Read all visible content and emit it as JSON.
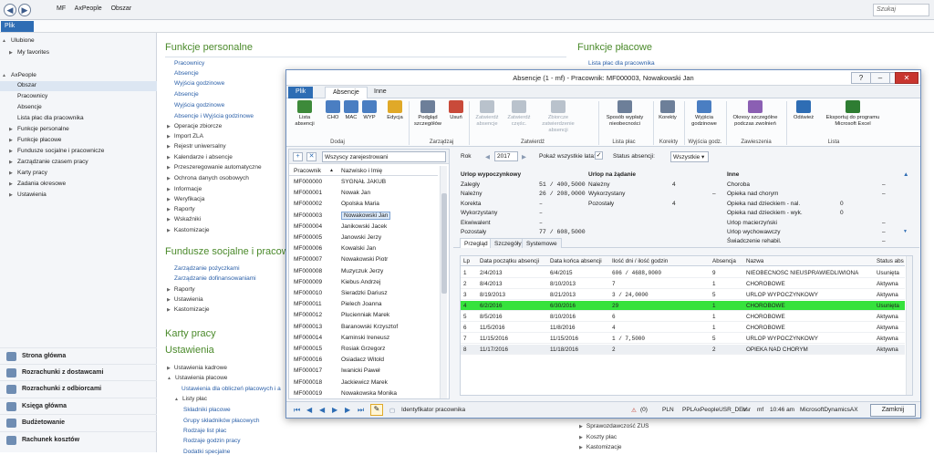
{
  "address": {
    "crumbs": [
      "MF",
      "AxPeople",
      "Obszar"
    ],
    "search_placeholder": "Szukaj"
  },
  "file_menu": "Plik",
  "sidebar": {
    "items": [
      {
        "label": "Ulubione",
        "level": 0,
        "arrow": "▲"
      },
      {
        "label": "My favorites",
        "level": 1,
        "arrow": "▶"
      },
      {
        "label": "AxPeople",
        "level": 0,
        "arrow": "▲"
      },
      {
        "label": "Obszar",
        "level": 1,
        "arrow": "",
        "selected": true
      },
      {
        "label": "Pracownicy",
        "level": 1,
        "arrow": ""
      },
      {
        "label": "Absencje",
        "level": 1,
        "arrow": ""
      },
      {
        "label": "Lista płac dla pracownika",
        "level": 1,
        "arrow": ""
      },
      {
        "label": "Funkcje personalne",
        "level": 1,
        "arrow": "▶"
      },
      {
        "label": "Funkcje płacowe",
        "level": 1,
        "arrow": "▶"
      },
      {
        "label": "Fundusze socjalne i pracownicze",
        "level": 1,
        "arrow": "▶"
      },
      {
        "label": "Zarządzanie czasem pracy",
        "level": 1,
        "arrow": "▶"
      },
      {
        "label": "Karty pracy",
        "level": 1,
        "arrow": "▶"
      },
      {
        "label": "Zadania okresowe",
        "level": 1,
        "arrow": "▶"
      },
      {
        "label": "Ustawienia",
        "level": 1,
        "arrow": "▶"
      }
    ],
    "nav": [
      "Strona główna",
      "Rozrachunki z dostawcami",
      "Rozrachunki z odbiorcami",
      "Księga główna",
      "Budżetowanie",
      "Rachunek kosztów"
    ]
  },
  "content": {
    "sections": {
      "personal": "Funkcje personalne",
      "payroll": "Funkcje płacowe",
      "funds": "Fundusze socjalne i pracow",
      "cards": "Karty pracy",
      "settings": "Ustawienia"
    },
    "personal_links": [
      "Pracownicy",
      "Absencje",
      "Wyjścia godzinowe",
      "Absencje",
      "Wyjścia godzinowe",
      "Absencje i Wyjścia godzinowe"
    ],
    "personal_groups": [
      "Operacje zbiorcze",
      "Import ZLA",
      "Rejestr uniwersalny",
      "Kalendarze i absencje",
      "Przeszeregowanie automatyczne",
      "Ochrona danych osobowych",
      "Informacje",
      "Weryfikacja",
      "Raporty",
      "Wskaźniki",
      "Kastomizacje"
    ],
    "payroll_link": "Lista płac dla pracownika",
    "funds_links": [
      "Zarządzanie pożyczkami",
      "Zarządzanie dofinansowaniami"
    ],
    "funds_groups": [
      "Raporty",
      "Ustawienia",
      "Kastomizacje"
    ],
    "settings_items": [
      "Ustawienia kadrowe",
      "Ustawienia płacowe",
      "Ustawienia dla obliczeń płacowych i a",
      "Listy płac",
      "Składniki płacowe",
      "Grupy składników płacowych",
      "Rodzaje list płac",
      "Rodzaje godzin pracy",
      "Dodatki specjalne"
    ],
    "bottom_right": [
      "Sprawozdawczość ZUS",
      "Koszty płac",
      "Kastomizacje"
    ]
  },
  "dialog": {
    "title": "Absencje (1 - mf) - Pracownik: MF000003, Nowakowski Jan",
    "tabs": {
      "file": "Plik",
      "active": "Absencje",
      "other": "Inne"
    },
    "ribbon_buttons": [
      {
        "label": "Lista absencji",
        "color": "#3d8a3a",
        "dis": false
      },
      {
        "label": "CHO",
        "color": "#4a7ec2",
        "dis": false
      },
      {
        "label": "MAC",
        "color": "#4a7ec2",
        "dis": false
      },
      {
        "label": "WYP",
        "color": "#4a7ec2",
        "dis": false
      },
      {
        "label": "Edycja",
        "color": "#e0a928",
        "dis": false
      },
      {
        "label": "Podgląd szczegółów",
        "color": "#6d7f99",
        "dis": false
      },
      {
        "label": "Usuń",
        "color": "#c94a3a",
        "dis": false
      },
      {
        "label": "Zatwierdź absencje",
        "color": "#b9c2cc",
        "dis": true
      },
      {
        "label": "Zatwierdź częśc.",
        "color": "#b9c2cc",
        "dis": true
      },
      {
        "label": "Zbiorcze zatwierdzenie absencji",
        "color": "#b9c2cc",
        "dis": true
      },
      {
        "label": "Sposób wypłaty nieobecności",
        "color": "#6d7f99",
        "dis": false
      },
      {
        "label": "Korekty",
        "color": "#6d7f99",
        "dis": false
      },
      {
        "label": "Wyjścia godzinowe",
        "color": "#4a7ec2",
        "dis": false
      },
      {
        "label": "Okresy szczególne podczas zwolnień",
        "color": "#8b5fb3",
        "dis": false
      },
      {
        "label": "Odśwież",
        "color": "#2e6db4",
        "dis": false
      },
      {
        "label": "Eksportuj do programu Microsoft Excel",
        "color": "#2e7d32",
        "dis": false
      }
    ],
    "ribbon_groups": [
      "Dodaj",
      "Zarządzaj",
      "Zatwierdź",
      "Lista płac",
      "Korekty",
      "Wyjścia godz.",
      "Zawieszenia",
      "Lista"
    ],
    "filter": "Wszyscy zarejestrowani",
    "emp_headers": [
      "Pracownik",
      "Nazwisko i Imię"
    ],
    "employees": [
      [
        "MF000000",
        "SYGNAŁ JAKUB"
      ],
      [
        "MF000001",
        "Nowak Jan"
      ],
      [
        "MF000002",
        "Opolska Maria"
      ],
      [
        "MF000003",
        "Nowakowski Jan"
      ],
      [
        "MF000004",
        "Janikowski Jacek"
      ],
      [
        "MF000005",
        "Janowski Jerzy"
      ],
      [
        "MF000006",
        "Kowalski Jan"
      ],
      [
        "MF000007",
        "Nowakowski Piotr"
      ],
      [
        "MF000008",
        "Muzyczuk Jerzy"
      ],
      [
        "MF000009",
        "Kiebus Andrzej"
      ],
      [
        "MF000010",
        "Sieradzki Dariusz"
      ],
      [
        "MF000011",
        "Pielech Joanna"
      ],
      [
        "MF000012",
        "Plucienniak Marek"
      ],
      [
        "MF000013",
        "Baranowski Krzysztof"
      ],
      [
        "MF000014",
        "Kaminski Ireneusz"
      ],
      [
        "MF000015",
        "Rosiak Grzegorz"
      ],
      [
        "MF000016",
        "Osiadacz Witold"
      ],
      [
        "MF000017",
        "Iwanicki Paweł"
      ],
      [
        "MF000018",
        "Jackiewicz Marek"
      ],
      [
        "MF000019",
        "Nowakowska Monika"
      ]
    ],
    "rok_label": "Rok",
    "rok": "2017",
    "show_all": "Pokaż wszystkie lata:",
    "status_label": "Status absencji:",
    "status_value": "Wszystkie",
    "leave": {
      "title": "Urlop wypoczynkowy",
      "rows": [
        [
          "Zaległy",
          "51 / 400,5000"
        ],
        [
          "Należny",
          "26 / 208,0000"
        ],
        [
          "Korekta",
          "–"
        ],
        [
          "Wykorzystany",
          "–"
        ],
        [
          "Ekwiwalent",
          "–"
        ],
        [
          "Pozostały",
          "77 / 608,5000"
        ]
      ]
    },
    "demand": {
      "title": "Urlop na żądanie",
      "rows": [
        [
          "Należny",
          "4"
        ],
        [
          "Wykorzystany",
          "–"
        ],
        [
          "Pozostały",
          "4"
        ]
      ]
    },
    "other": {
      "title": "Inne",
      "rows": [
        [
          "Choroba",
          "–"
        ],
        [
          "Opieka nad chorym",
          "–"
        ],
        [
          "Opieka nad dzieckiem - nal.",
          "0"
        ],
        [
          "Opieka nad dzieckiem - wyk.",
          "0"
        ],
        [
          "Urlop macierzyński",
          "–"
        ],
        [
          "Urlop wychowawczy",
          "–"
        ],
        [
          "Świadczenie rehabil.",
          "–"
        ]
      ]
    },
    "sub_tabs": [
      "Przegląd",
      "Szczegóły",
      "Systemowe"
    ],
    "grid_headers": [
      "Lp",
      "Data początku absencji",
      "Data końca absencji",
      "Ilość dni / ilość godzin",
      "Absencja",
      "Nazwa",
      "Status abs"
    ],
    "grid_rows": [
      [
        "1",
        "2/4/2013",
        "6/4/2015",
        "606 / 4688,0000",
        "9",
        "NIEOBECNOSC NIEUSPRAWIEDLIWIONA",
        "Usunięta"
      ],
      [
        "2",
        "8/4/2013",
        "8/10/2013",
        "7",
        "1",
        "CHOROBOWE",
        "Aktywna"
      ],
      [
        "3",
        "8/19/2013",
        "8/21/2013",
        "3 / 24,0000",
        "5",
        "URLOP WYPOCZYNKOWY",
        "Aktywna"
      ],
      [
        "4",
        "6/2/2016",
        "6/30/2016",
        "29",
        "1",
        "CHOROBOWE",
        "Usunięta"
      ],
      [
        "5",
        "8/5/2016",
        "8/10/2016",
        "6",
        "1",
        "CHOROBOWE",
        "Aktywna"
      ],
      [
        "6",
        "11/5/2016",
        "11/8/2016",
        "4",
        "1",
        "CHOROBOWE",
        "Aktywna"
      ],
      [
        "7",
        "11/15/2016",
        "11/15/2016",
        "1 / 7,5000",
        "5",
        "URLOP WYPOCZYNKOWY",
        "Aktywna"
      ],
      [
        "8",
        "11/17/2016",
        "11/18/2016",
        "2",
        "2",
        "OPIEKA NAD CHORYM",
        "Aktywna"
      ]
    ],
    "selected_row": 3,
    "status_bar": {
      "field": "Identyfikator pracownika",
      "count": "(0)",
      "currency": "PLN",
      "db": "PPLAxPeopleUSR_DEV",
      "usr": "usr",
      "company": "mf",
      "time": "10:46 am",
      "app": "MicrosoftDynamicsAX",
      "close": "Zamknij"
    }
  }
}
